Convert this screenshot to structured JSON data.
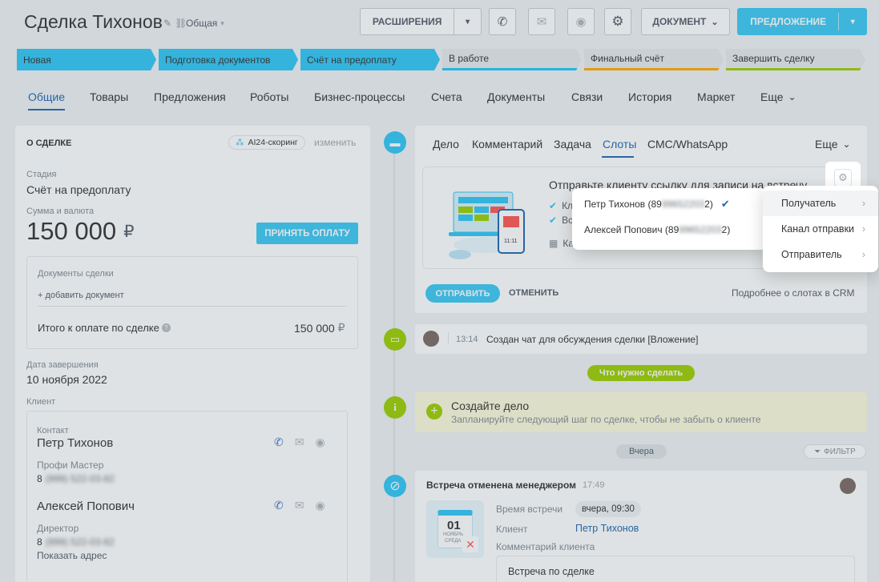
{
  "header": {
    "title": "Сделка Тихонов",
    "category": "Общая",
    "extensions_label": "РАСШИРЕНИЯ",
    "document_label": "ДОКУМЕНТ",
    "offer_label": "ПРЕДЛОЖЕНИЕ"
  },
  "stages": [
    {
      "label": "Новая"
    },
    {
      "label": "Подготовка документов"
    },
    {
      "label": "Счёт на предоплату"
    },
    {
      "label": "В работе"
    },
    {
      "label": "Финальный счёт"
    },
    {
      "label": "Завершить сделку"
    }
  ],
  "tabs": [
    "Общие",
    "Товары",
    "Предложения",
    "Роботы",
    "Бизнес-процессы",
    "Счета",
    "Документы",
    "Связи",
    "История",
    "Маркет",
    "Еще"
  ],
  "deal": {
    "section_title": "О СДЕЛКЕ",
    "scoring_label": "AI24-скоринг",
    "edit_label": "изменить",
    "stage_label": "Стадия",
    "stage_value": "Счёт на предоплату",
    "amount_label": "Сумма и валюта",
    "amount_value": "150 000",
    "currency": "₽",
    "accept_payment": "ПРИНЯТЬ ОПЛАТУ",
    "docs_label": "Документы сделки",
    "add_doc": "+ добавить документ",
    "total_label": "Итого к оплате по сделке",
    "total_value": "150 000",
    "close_date_label": "Дата завершения",
    "close_date_value": "10 ноября 2022",
    "client_label": "Клиент",
    "contact_label": "Контакт",
    "contact1_name": "Петр Тихонов",
    "contact1_company": "Профи Мастер",
    "contact1_phone_prefix": "8",
    "contact1_phone_blur": "(999) 522-03-82",
    "contact2_name": "Алексей Попович",
    "contact2_role": "Директор",
    "contact2_phone_prefix": "8",
    "contact2_phone_blur": "(999) 522-03-82",
    "show_address": "Показать адрес"
  },
  "activity_tabs": [
    "Дело",
    "Комментарий",
    "Задача",
    "Слоты",
    "СМС/WhatsApp"
  ],
  "activity_more": "Еще",
  "slots": {
    "heading": "Отправьте клиенту ссылку для записи на встречу",
    "line1": "Кл",
    "line2": "Вс",
    "line3": "Ка",
    "send": "ОТПРАВИТЬ",
    "cancel": "ОТМЕНИТЬ",
    "more_link": "Подробнее о слотах в CRM",
    "calendar_time": "11:11"
  },
  "recipients": [
    {
      "name_prefix": "Петр Тихонов (89",
      "name_blur": "99652203",
      "name_suffix": "2)",
      "checked": true
    },
    {
      "name_prefix": "Алексей Попович (89",
      "name_blur": "99652203",
      "name_suffix": "2)",
      "checked": false
    }
  ],
  "settings_menu": [
    "Получатель",
    "Канал отправки",
    "Отправитель"
  ],
  "feed": {
    "chat_time": "13:14",
    "chat_text": "Создан чат для обсуждения сделки [Вложение]",
    "todo_badge": "Что нужно сделать",
    "create_title": "Создайте дело",
    "create_sub": "Запланируйте следующий шаг по сделке, чтобы не забыть о клиенте",
    "yesterday": "Вчера",
    "filter": "ФИЛЬТР",
    "meeting_title": "Встреча отменена менеджером",
    "meeting_time": "17:49",
    "meeting_time_label": "Время встречи",
    "meeting_time_value": "вчера, 09:30",
    "client_label": "Клиент",
    "client_value": "Петр Тихонов",
    "comment_label": "Комментарий клиента",
    "comment_value": "Встреча по сделке",
    "cal_day": "01",
    "cal_month": "НОЯБРЬ",
    "cal_weekday": "СРЕДА"
  },
  "colors": {
    "accent": "#2fc6f6",
    "green": "#9dcf00",
    "link": "#2067b0",
    "primary_button": "#3bc8f5"
  }
}
